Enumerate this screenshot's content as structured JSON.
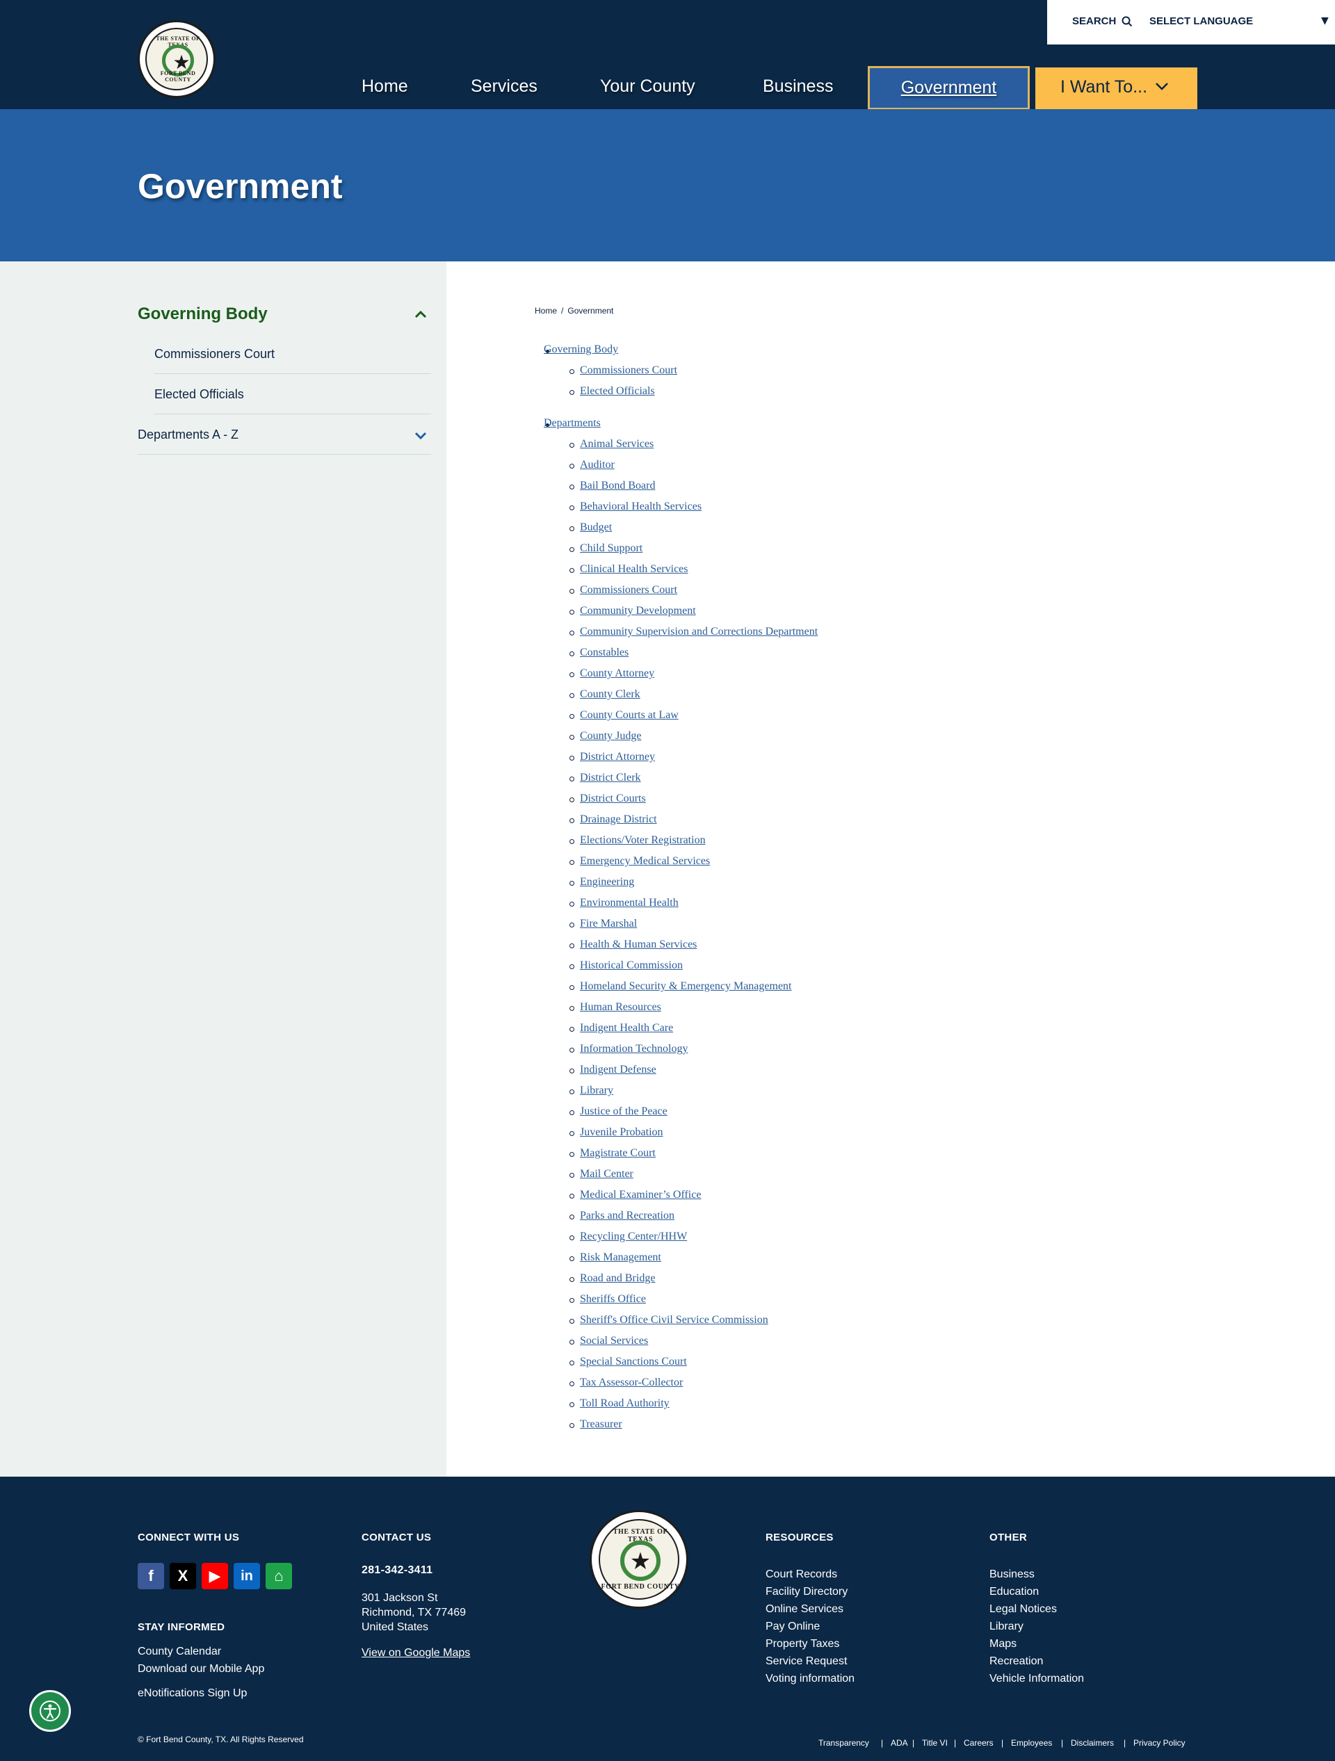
{
  "logo": {
    "top_text": "THE STATE OF TEXAS",
    "bottom_text": "FORT BEND COUNTY"
  },
  "utility": {
    "search_label": "SEARCH",
    "language_label": "SELECT LANGUAGE"
  },
  "nav": {
    "items": [
      "Home",
      "Services",
      "Your County",
      "Business",
      "Government"
    ],
    "want_label": "I Want To..."
  },
  "banner": {
    "title": "Government"
  },
  "sidebar": {
    "heading": "Governing Body",
    "sub_items": [
      "Commissioners Court",
      "Elected Officials"
    ],
    "departments_label": "Departments A - Z"
  },
  "breadcrumb": {
    "home": "Home",
    "sep": "/",
    "current": "Government"
  },
  "content": {
    "group1": {
      "label": "Governing Body",
      "items": [
        "Commissioners Court",
        "Elected Officials"
      ]
    },
    "group2": {
      "label": "Departments",
      "items": [
        "Animal Services",
        "Auditor",
        "Bail Bond Board",
        "Behavioral Health Services",
        "Budget",
        "Child Support",
        "Clinical Health Services",
        "Commissioners Court",
        "Community Development",
        "Community Supervision and Corrections Department",
        "Constables",
        "County Attorney",
        "County Clerk",
        "County Courts at Law",
        "County Judge",
        "District Attorney",
        "District Clerk",
        "District Courts",
        "Drainage District",
        "Elections/Voter Registration",
        "Emergency Medical Services",
        "Engineering",
        "Environmental Health",
        "Fire Marshal",
        "Health & Human Services",
        "Historical Commission",
        "Homeland Security & Emergency Management",
        "Human Resources",
        "Indigent Health Care",
        "Information Technology",
        "Indigent Defense",
        "Library",
        "Justice of the Peace",
        "Juvenile Probation",
        "Magistrate Court",
        "Mail Center",
        "Medical Examiner’s Office",
        "Parks and Recreation",
        "Recycling Center/HHW",
        "Risk Management",
        "Road and Bridge",
        "Sheriffs Office",
        "Sheriff's Office Civil Service Commission",
        "Social Services",
        "Special Sanctions Court",
        "Tax Assessor-Collector",
        "Toll Road Authority",
        "Treasurer"
      ]
    }
  },
  "footer": {
    "connect_heading": "CONNECT WITH US",
    "social": [
      {
        "icon": "facebook-icon",
        "glyph": "f",
        "color": "#3b5998"
      },
      {
        "icon": "x-twitter-icon",
        "glyph": "X",
        "color": "#000000"
      },
      {
        "icon": "youtube-icon",
        "glyph": "▶",
        "color": "#ff0000"
      },
      {
        "icon": "linkedin-icon",
        "glyph": "in",
        "color": "#0a66c2"
      },
      {
        "icon": "nextdoor-icon",
        "glyph": "⌂",
        "color": "#1fa34a"
      }
    ],
    "stay_heading": "STAY INFORMED",
    "stay_links": [
      "County Calendar",
      "Download our Mobile App",
      "eNotifications Sign Up"
    ],
    "contact_heading": "CONTACT US",
    "phone": "281-342-3411",
    "address_lines": [
      "301 Jackson St",
      "Richmond, TX 77469",
      "United States"
    ],
    "map_link": "View on Google Maps",
    "resources_heading": "RESOURCES",
    "resources": [
      "Court Records",
      "Facility Directory",
      "Online Services",
      "Pay Online",
      "Property Taxes",
      "Service Request",
      "Voting information"
    ],
    "other_heading": "OTHER",
    "other": [
      "Business",
      "Education",
      "Legal Notices",
      "Library",
      "Maps",
      "Recreation",
      "Vehicle Information"
    ],
    "copyright": "© Fort Bend County, TX. All Rights Reserved",
    "legal": [
      "Transparency",
      "ADA",
      "Title VI",
      "Careers",
      "Employees",
      "Disclaimers",
      "Privacy Policy"
    ]
  }
}
